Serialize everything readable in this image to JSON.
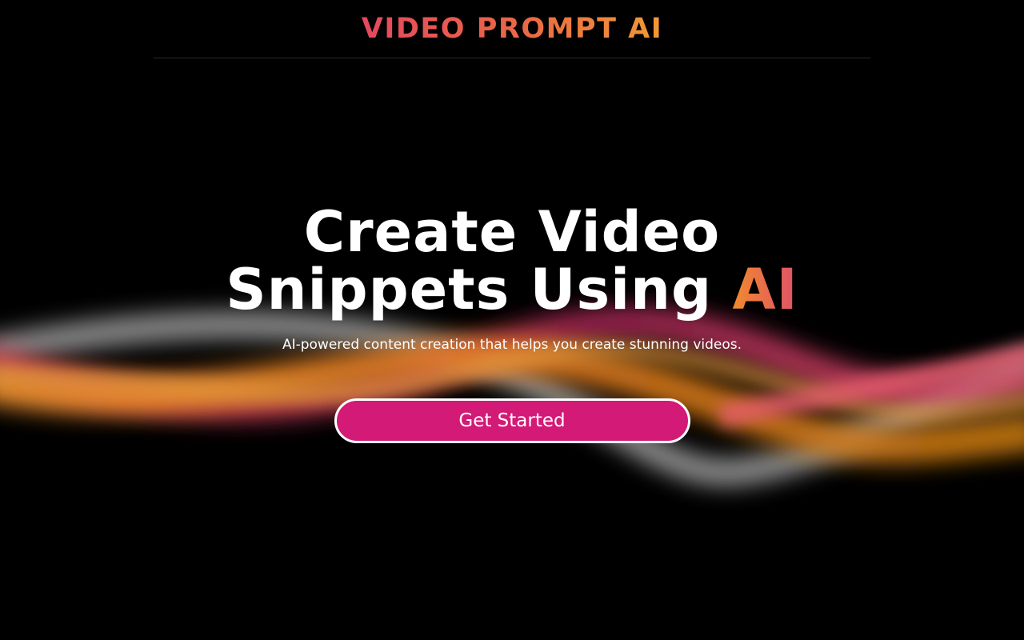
{
  "header": {
    "brand": "VIDEO PROMPT AI"
  },
  "hero": {
    "headline_line1": "Create Video",
    "headline_line2": "Snippets Using",
    "headline_accent": "AI",
    "subtitle": "AI-powered content creation that helps you create stunning videos.",
    "cta_label": "Get Started"
  },
  "colors": {
    "background": "#000000",
    "brand_gradient_start": "#e4485f",
    "brand_gradient_end": "#f09a35",
    "cta_background": "#d31a76",
    "cta_border": "#ffffff"
  }
}
